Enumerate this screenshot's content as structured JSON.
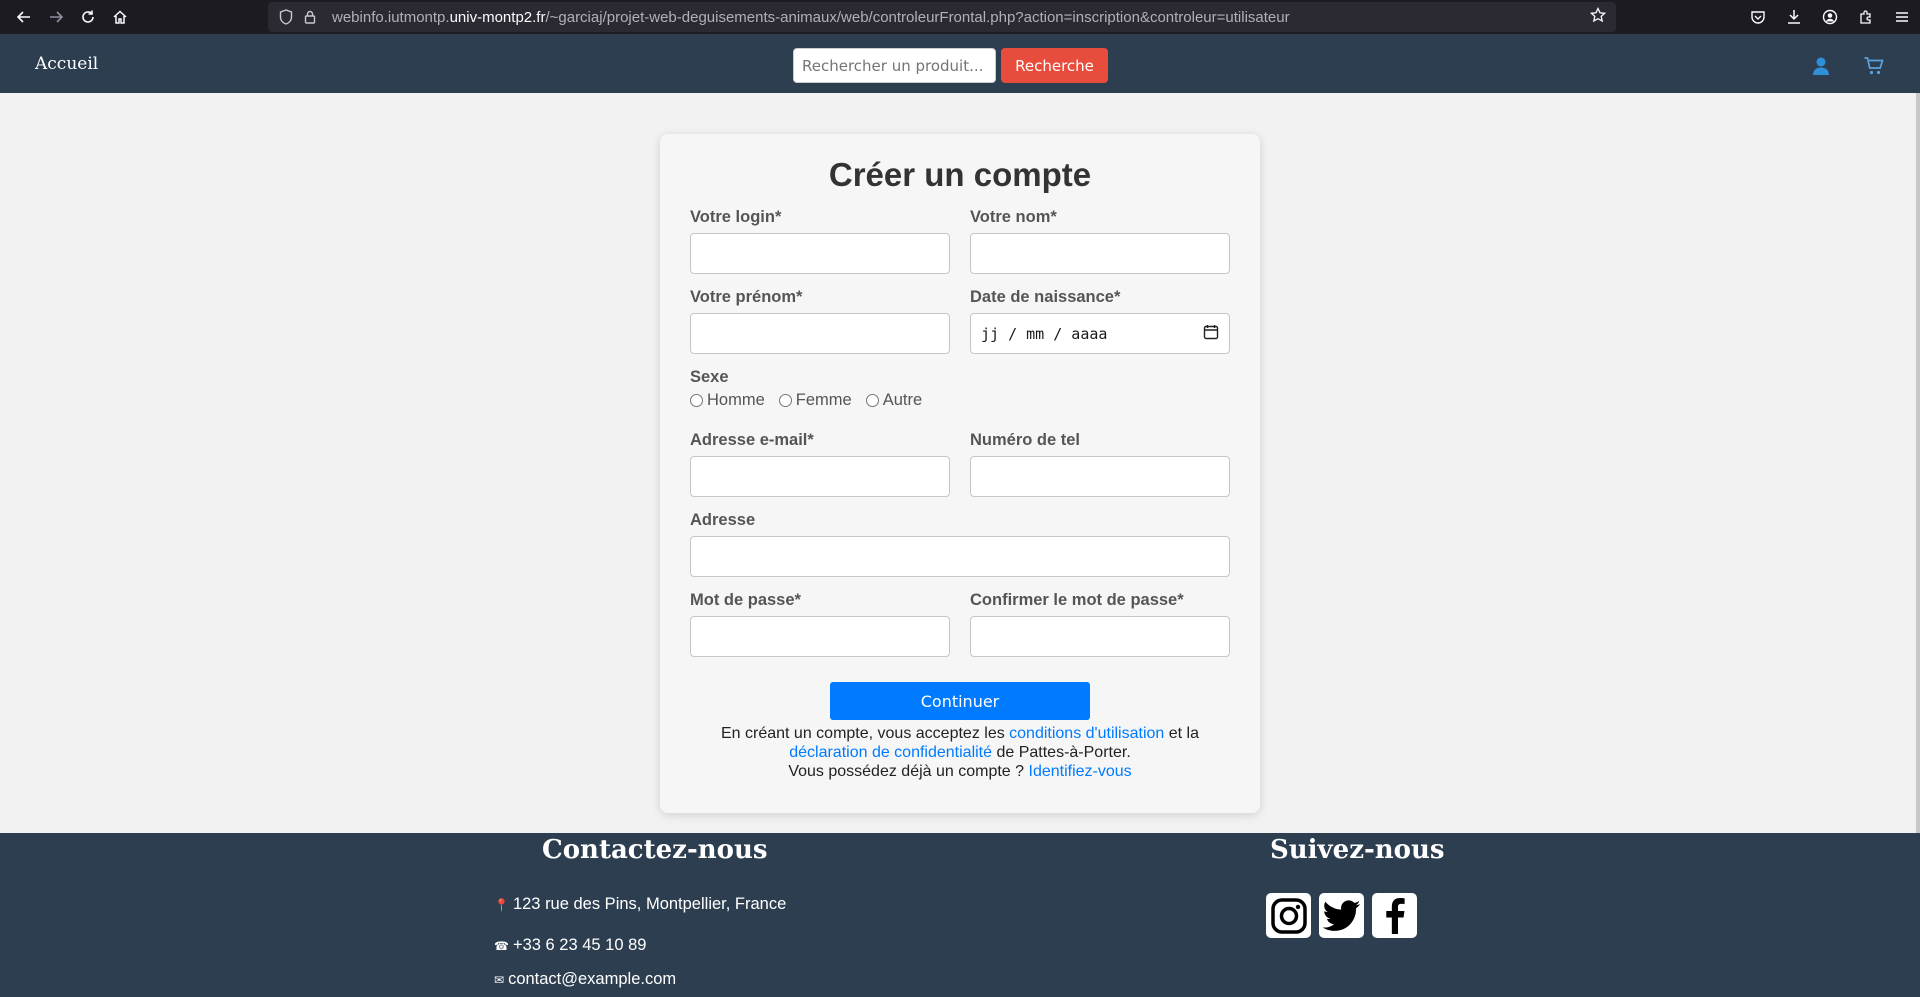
{
  "browser": {
    "url_prefix": "webinfo.iutmontp.",
    "url_host": "univ-montp2.fr",
    "url_path": "/~garciaj/projet-web-deguisements-animaux/web/controleurFrontal.php?action=inscription&controleur=utilisateur"
  },
  "header": {
    "home_label": "Accueil",
    "search_placeholder": "Rechercher un produit...",
    "search_button": "Recherche",
    "user_icon": "user-icon",
    "cart_icon": "cart-icon"
  },
  "form": {
    "title": "Créer un compte",
    "login_label": "Votre login*",
    "nom_label": "Votre nom*",
    "prenom_label": "Votre prénom*",
    "date_label": "Date de naissance*",
    "date_placeholder": "jj / mm / aaaa",
    "sexe_label": "Sexe",
    "sexe_options": [
      "Homme",
      "Femme",
      "Autre"
    ],
    "email_label": "Adresse e-mail*",
    "tel_label": "Numéro de tel",
    "adresse_label": "Adresse",
    "mdp_label": "Mot de passe*",
    "mdp_confirm_label": "Confirmer le mot de passe*",
    "submit_label": "Continuer"
  },
  "terms": {
    "text_1": "En créant un compte, vous acceptez les ",
    "link_conditions": "conditions d'utilisation",
    "text_2": " et la",
    "link_declaration": "déclaration de confidentialité",
    "text_3": " de Pattes-à-Porter.",
    "text_4": "Vous possédez déjà un compte ? ",
    "link_login": "Identifiez-vous"
  },
  "footer": {
    "contact_title": "Contactez-nous",
    "address": "123 rue des Pins, Montpellier, France",
    "phone": "+33 6 23 45 10 89",
    "email": "contact@example.com",
    "social_title": "Suivez-nous",
    "social_icons": [
      "instagram-icon",
      "twitter-icon",
      "facebook-icon"
    ]
  },
  "colors": {
    "header_bg": "#2c3e50",
    "search_button_bg": "#e74c3c",
    "primary": "#007bff"
  }
}
